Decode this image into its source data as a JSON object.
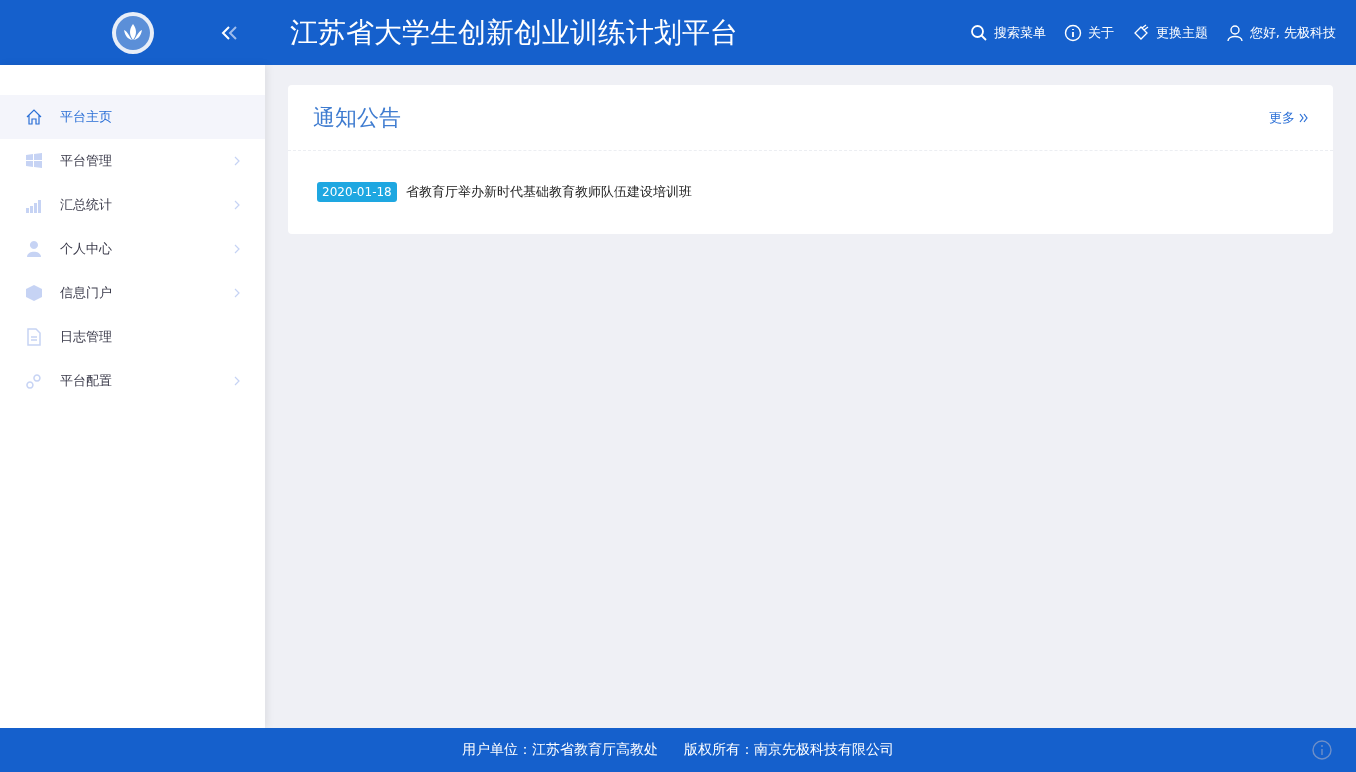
{
  "header": {
    "title": "江苏省大学生创新创业训练计划平台",
    "actions": [
      {
        "label": "搜索菜单"
      },
      {
        "label": "关于"
      },
      {
        "label": "更换主题"
      },
      {
        "label": "您好, 先极科技"
      }
    ]
  },
  "sidebar": {
    "items": [
      {
        "label": "平台主页",
        "selected": true,
        "has_submenu": false
      },
      {
        "label": "平台管理",
        "selected": false,
        "has_submenu": true
      },
      {
        "label": "汇总统计",
        "selected": false,
        "has_submenu": true
      },
      {
        "label": "个人中心",
        "selected": false,
        "has_submenu": true
      },
      {
        "label": "信息门户",
        "selected": false,
        "has_submenu": true
      },
      {
        "label": "日志管理",
        "selected": false,
        "has_submenu": false
      },
      {
        "label": "平台配置",
        "selected": false,
        "has_submenu": true
      }
    ]
  },
  "notice_panel": {
    "title": "通知公告",
    "more": "更多",
    "items": [
      {
        "date": "2020-01-18",
        "title": "省教育厅举办新时代基础教育教师队伍建设培训班"
      }
    ]
  },
  "footer": {
    "texts": [
      "用户单位：江苏省教育厅高教处",
      "版权所有：南京先极科技有限公司"
    ]
  }
}
